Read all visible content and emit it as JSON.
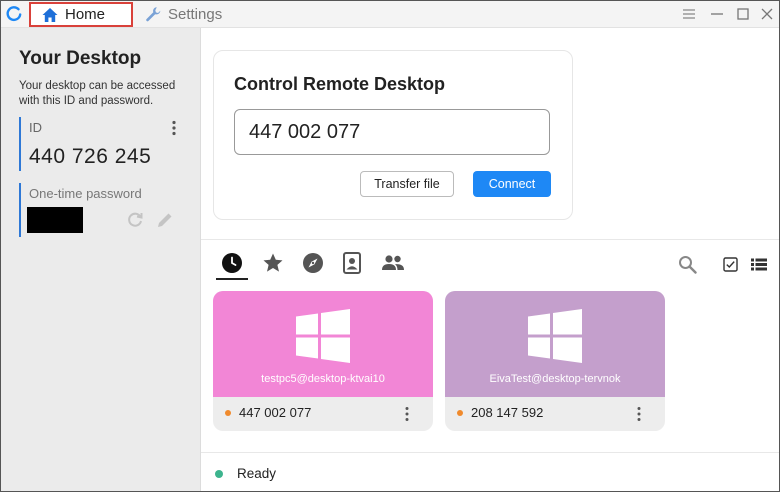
{
  "titlebar": {
    "tabs": [
      {
        "label": "Home",
        "icon": "home-icon",
        "active": true
      },
      {
        "label": "Settings",
        "icon": "wrench-icon",
        "active": false
      }
    ],
    "window_controls": [
      "menu-icon",
      "minimize-icon",
      "maximize-icon",
      "close-icon"
    ]
  },
  "sidebar": {
    "title": "Your Desktop",
    "description": "Your desktop can be accessed with this ID and password.",
    "id_label": "ID",
    "id_value": "440 726 245",
    "password_label": "One-time password"
  },
  "control": {
    "title": "Control Remote Desktop",
    "remote_id_value": "447 002 077",
    "transfer_label": "Transfer file",
    "connect_label": "Connect"
  },
  "peer_tabs": [
    "recent-sessions-icon",
    "favorites-icon",
    "discovered-icon",
    "address-book-icon",
    "group-icon"
  ],
  "peers": [
    {
      "host": "testpc5@desktop-ktvai10",
      "id": "447 002 077",
      "color": "#f286d6",
      "status_color": "#f08a2c"
    },
    {
      "host": "EivaTest@desktop-tervnok",
      "id": "208 147 592",
      "color": "#c49fcc",
      "status_color": "#f08a2c"
    }
  ],
  "status": {
    "text": "Ready",
    "color": "#3db48e"
  },
  "colors": {
    "accent": "#1e88f5",
    "highlight_border": "#d9413a"
  }
}
